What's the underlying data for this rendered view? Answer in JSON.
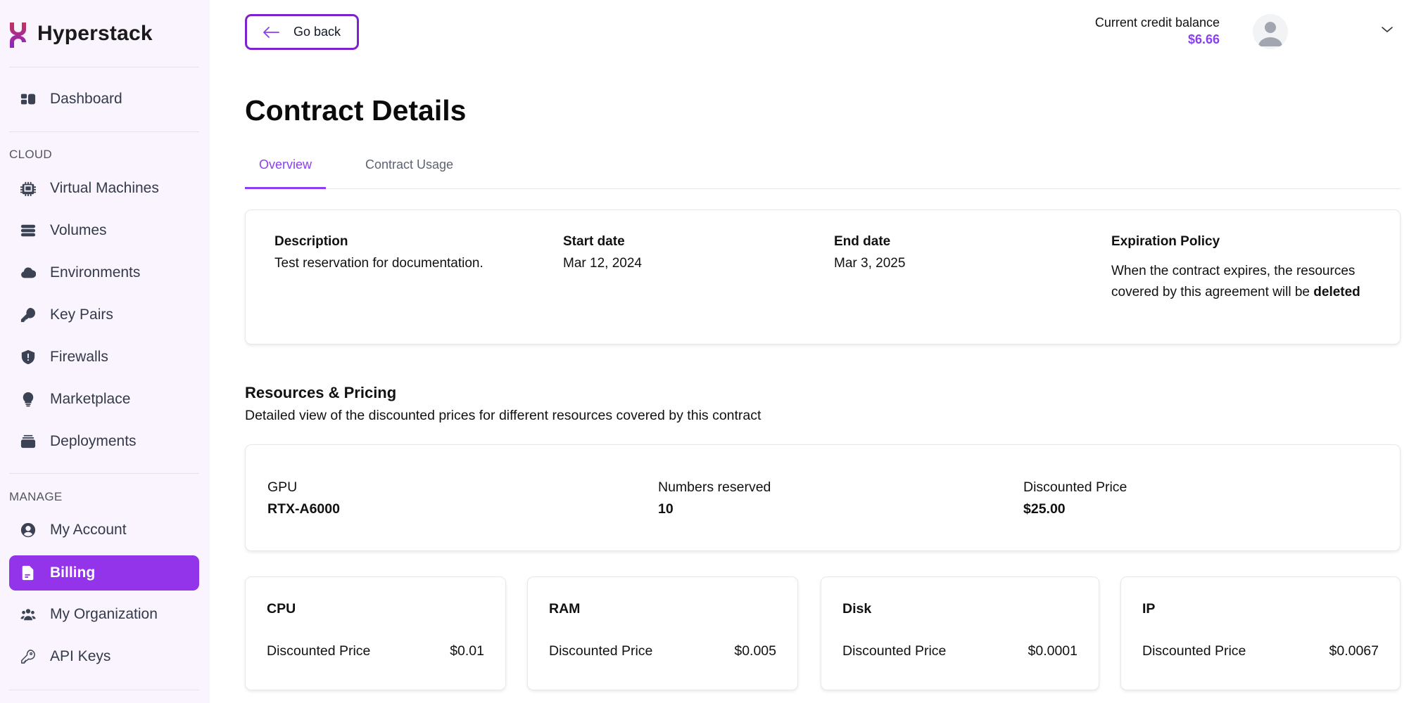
{
  "brand": {
    "name": "Hyperstack",
    "accent": "#9333ea"
  },
  "sidebar": {
    "dashboard": {
      "label": "Dashboard",
      "icon": "dashboard-icon"
    },
    "sections": [
      {
        "label": "CLOUD",
        "items": [
          {
            "label": "Virtual Machines",
            "icon": "chip-icon"
          },
          {
            "label": "Volumes",
            "icon": "server-stack-icon"
          },
          {
            "label": "Environments",
            "icon": "cloud-icon"
          },
          {
            "label": "Key Pairs",
            "icon": "key-icon"
          },
          {
            "label": "Firewalls",
            "icon": "shield-icon"
          },
          {
            "label": "Marketplace",
            "icon": "lightbulb-icon"
          },
          {
            "label": "Deployments",
            "icon": "stack-icon"
          }
        ]
      },
      {
        "label": "MANAGE",
        "items": [
          {
            "label": "My Account",
            "icon": "user-circle-icon"
          },
          {
            "label": "Billing",
            "icon": "document-icon",
            "active": true
          },
          {
            "label": "My Organization",
            "icon": "users-icon"
          },
          {
            "label": "API Keys",
            "icon": "key-outline-icon"
          }
        ]
      }
    ]
  },
  "header": {
    "go_back_label": "Go back",
    "credit_label": "Current credit balance",
    "credit_value": "$6.66"
  },
  "page": {
    "title": "Contract Details",
    "tabs": [
      {
        "label": "Overview",
        "active": true
      },
      {
        "label": "Contract Usage",
        "active": false
      }
    ]
  },
  "overview": {
    "description_label": "Description",
    "description_value": "Test reservation for documentation.",
    "start_label": "Start date",
    "start_value": "Mar 12, 2024",
    "end_label": "End date",
    "end_value": "Mar 3, 2025",
    "policy_label": "Expiration Policy",
    "policy_text": "When the contract expires, the resources covered by this agreement will be",
    "policy_action": "deleted"
  },
  "resources": {
    "title": "Resources & Pricing",
    "subtitle": "Detailed view of the discounted prices for different resources covered by this contract",
    "gpu": {
      "gpu_label": "GPU",
      "gpu_value": "RTX-A6000",
      "reserved_label": "Numbers reserved",
      "reserved_value": "10",
      "price_label": "Discounted Price",
      "price_value": "$25.00"
    },
    "items": [
      {
        "name": "CPU",
        "price_label": "Discounted Price",
        "price": "$0.01"
      },
      {
        "name": "RAM",
        "price_label": "Discounted Price",
        "price": "$0.005"
      },
      {
        "name": "Disk",
        "price_label": "Discounted Price",
        "price": "$0.0001"
      },
      {
        "name": "IP",
        "price_label": "Discounted Price",
        "price": "$0.0067"
      }
    ]
  }
}
